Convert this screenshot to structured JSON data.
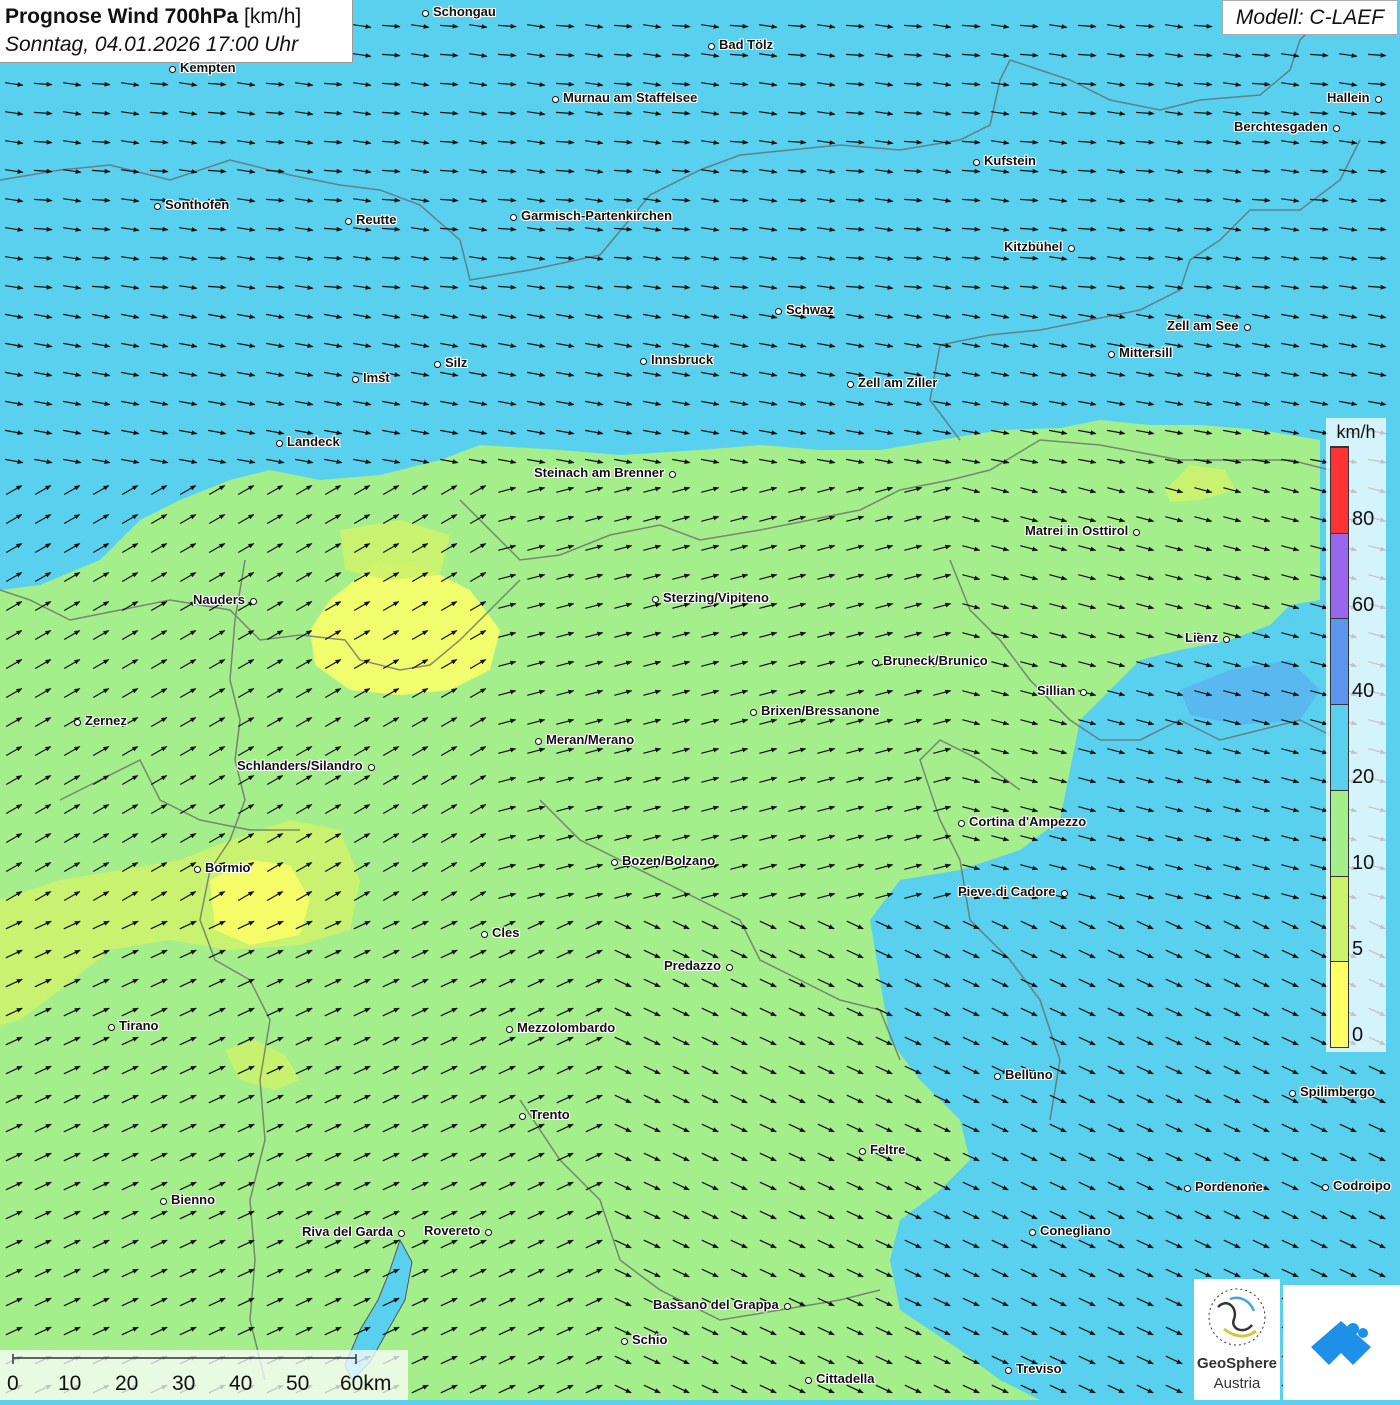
{
  "title": {
    "bold": "Prognose Wind 700hPa",
    "unit": "[km/h]",
    "datetime": "Sonntag, 04.01.2026 17:00 Uhr"
  },
  "model": "Modell: C-LAEF",
  "colors": {
    "wind_0_5": "#ffff66",
    "wind_5_10": "#ccf26b",
    "wind_10_20": "#a4ee8c",
    "wind_20_40": "#59d0ee",
    "wind_40_60": "#5b95ee",
    "wind_60_80": "#9966ee",
    "wind_80_plus": "#ff3333",
    "border": "#666666",
    "arrow": "#111111"
  },
  "legend": {
    "unit": "km/h",
    "labels": [
      "80",
      "60",
      "40",
      "20",
      "10",
      "5",
      "0"
    ],
    "bands": [
      {
        "from": 0,
        "to": 5,
        "color": "#ffff66"
      },
      {
        "from": 5,
        "to": 10,
        "color": "#ccf26b"
      },
      {
        "from": 10,
        "to": 20,
        "color": "#a4ee8c"
      },
      {
        "from": 20,
        "to": 40,
        "color": "#59d0ee"
      },
      {
        "from": 40,
        "to": 60,
        "color": "#5b95ee"
      },
      {
        "from": 60,
        "to": 80,
        "color": "#9966ee"
      },
      {
        "from": 80,
        "to": 100,
        "color": "#ff3333"
      }
    ]
  },
  "scalebar": {
    "labels": [
      "0",
      "10",
      "20",
      "30",
      "40",
      "50",
      "60km"
    ]
  },
  "logo": {
    "name": "GeoSphere",
    "sub": "Austria"
  },
  "cities": [
    {
      "name": "Schongau"
    },
    {
      "name": "Bad Tölz"
    },
    {
      "name": "Kempten"
    },
    {
      "name": "Murnau am Staffelsee"
    },
    {
      "name": "Hallein"
    },
    {
      "name": "Berchtesgaden"
    },
    {
      "name": "Kufstein"
    },
    {
      "name": "Sonthofen"
    },
    {
      "name": "Reutte"
    },
    {
      "name": "Garmisch-Partenkirchen"
    },
    {
      "name": "Kitzbühel"
    },
    {
      "name": "Schwaz"
    },
    {
      "name": "Zell am See"
    },
    {
      "name": "Mittersill"
    },
    {
      "name": "Innsbruck"
    },
    {
      "name": "Silz"
    },
    {
      "name": "Imst"
    },
    {
      "name": "Zell am Ziller"
    },
    {
      "name": "Landeck"
    },
    {
      "name": "Steinach am Brenner"
    },
    {
      "name": "Matrei in Osttirol"
    },
    {
      "name": "Nauders"
    },
    {
      "name": "Sterzing/Vipiteno"
    },
    {
      "name": "Lienz"
    },
    {
      "name": "Bruneck/Brunico"
    },
    {
      "name": "Sillian"
    },
    {
      "name": "Brixen/Bressanone"
    },
    {
      "name": "Zernez"
    },
    {
      "name": "Meran/Merano"
    },
    {
      "name": "Schlanders/Silandro"
    },
    {
      "name": "Cortina d'Ampezzo"
    },
    {
      "name": "Bozen/Bolzano"
    },
    {
      "name": "Bormio"
    },
    {
      "name": "Pieve di Cadore"
    },
    {
      "name": "Cles"
    },
    {
      "name": "Predazzo"
    },
    {
      "name": "Tirano"
    },
    {
      "name": "Mezzolombardo"
    },
    {
      "name": "Belluno"
    },
    {
      "name": "Spilimbergo"
    },
    {
      "name": "Trento"
    },
    {
      "name": "Feltre"
    },
    {
      "name": "Pordenone"
    },
    {
      "name": "Codroipo"
    },
    {
      "name": "Bienno"
    },
    {
      "name": "Riva del Garda"
    },
    {
      "name": "Rovereto"
    },
    {
      "name": "Conegliano"
    },
    {
      "name": "Bassano del Grappa"
    },
    {
      "name": "Schio"
    },
    {
      "name": "Treviso"
    },
    {
      "name": "Cittadella"
    }
  ]
}
